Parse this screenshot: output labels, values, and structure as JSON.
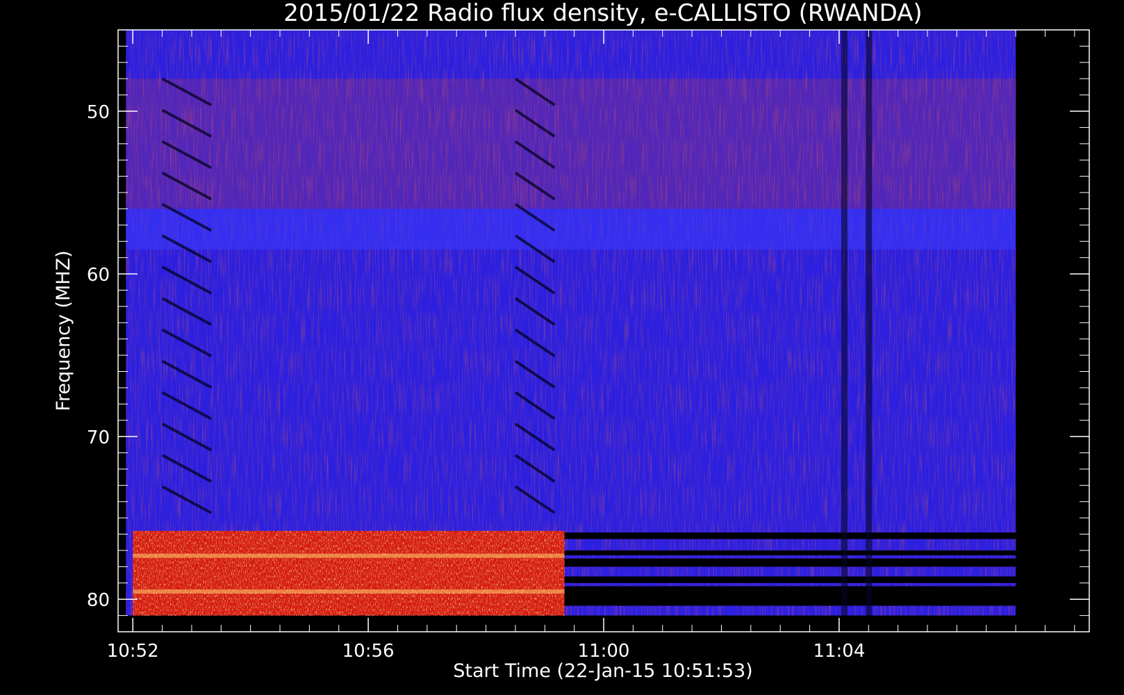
{
  "chart_data": {
    "type": "heatmap",
    "title": "2015/01/22  Radio flux density, e-CALLISTO (RWANDA)",
    "xlabel": "Start Time (22-Jan-15 10:51:53)",
    "ylabel": "Frequency (MHZ)",
    "x_range": [
      "10:51:53",
      "10:52",
      "11:07"
    ],
    "xlim": [
      "10:51:45",
      "11:08:15"
    ],
    "ylim": [
      45,
      82
    ],
    "y_reversed": true,
    "x_ticks": [
      "10:52",
      "10:56",
      "11:00",
      "11:04"
    ],
    "y_ticks": [
      50,
      60,
      70,
      80
    ],
    "grid": false,
    "legend": "none",
    "colormap": [
      "#000000",
      "#1a1aff",
      "#ff2200",
      "#ffaa33",
      "#ffffff"
    ],
    "colors": {
      "background": "#000000",
      "axes": "#ffffff",
      "dominant": "#2b1fe0",
      "burst": "#ff4a10",
      "noise_band": "#ffcf70"
    },
    "features": [
      {
        "label": "RFI band (strong)",
        "time_start": "10:52",
        "time_end": "10:59:20",
        "freq_start": 75.8,
        "freq_end": 81
      },
      {
        "label": "Blanked channels",
        "time_start": "10:59:20",
        "time_end": "11:07",
        "freq_start": 75.8,
        "freq_end": 81
      },
      {
        "label": "Vertical dark stripe",
        "time": "11:04:05",
        "freq_start": 45,
        "freq_end": 81
      },
      {
        "label": "Vertical dark stripe",
        "time": "11:04:30",
        "freq_start": 45,
        "freq_end": 81
      },
      {
        "label": "Faint drift pattern",
        "time_start": "10:52:30",
        "time_end": "10:53:20",
        "freq_start": 48,
        "freq_end": 75
      },
      {
        "label": "Faint drift pattern",
        "time_start": "10:58:30",
        "time_end": "10:59:10",
        "freq_start": 48,
        "freq_end": 75
      }
    ]
  }
}
